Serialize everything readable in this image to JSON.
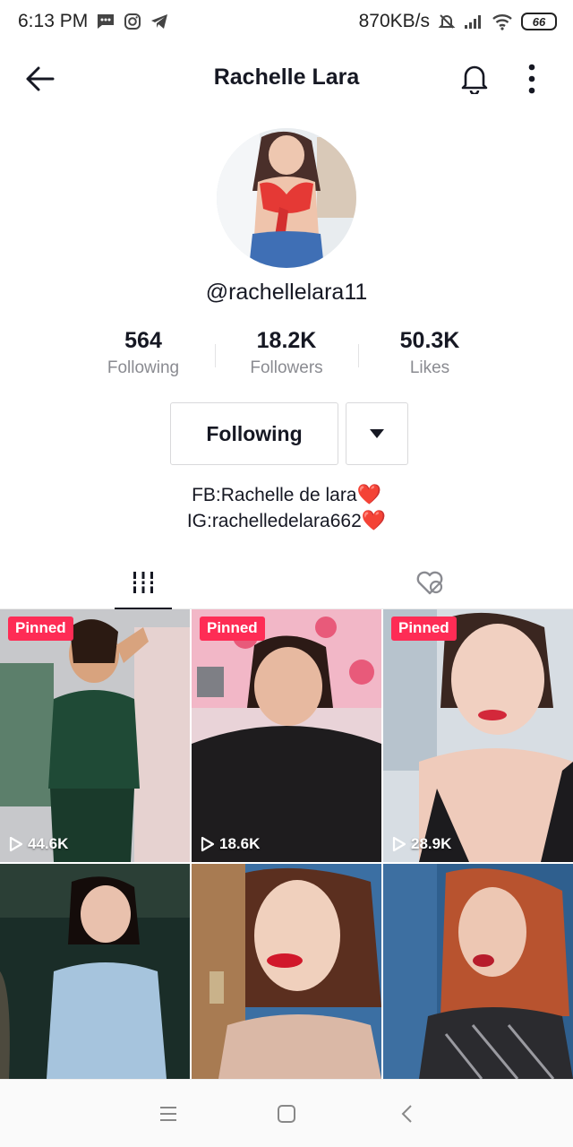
{
  "status_bar": {
    "time": "6:13 PM",
    "network_speed": "870KB/s",
    "battery": "66"
  },
  "header": {
    "title": "Rachelle Lara",
    "back_icon": "arrow-left-icon",
    "bell_icon": "bell-icon",
    "more_icon": "vertical-dots-icon"
  },
  "profile": {
    "handle": "@rachellelara11",
    "stats": [
      {
        "value": "564",
        "label": "Following"
      },
      {
        "value": "18.2K",
        "label": "Followers"
      },
      {
        "value": "50.3K",
        "label": "Likes"
      }
    ],
    "follow_button": "Following",
    "bio": [
      {
        "text": "FB:Rachelle de lara",
        "emoji": "❤️"
      },
      {
        "text": "IG:rachelledelara662",
        "emoji": "❤️"
      }
    ]
  },
  "tabs": [
    {
      "icon": "grid-lines-icon",
      "active": true
    },
    {
      "icon": "hidden-heart-icon",
      "active": false
    }
  ],
  "videos": [
    {
      "pinned": "Pinned",
      "views": "44.6K"
    },
    {
      "pinned": "Pinned",
      "views": "18.6K"
    },
    {
      "pinned": "Pinned",
      "views": "28.9K"
    },
    {
      "pinned": null,
      "views": null
    },
    {
      "pinned": null,
      "views": null
    },
    {
      "pinned": null,
      "views": null
    }
  ],
  "colors": {
    "accent": "#fe2c55",
    "text_primary": "#161823",
    "text_secondary": "#8a8b91"
  }
}
